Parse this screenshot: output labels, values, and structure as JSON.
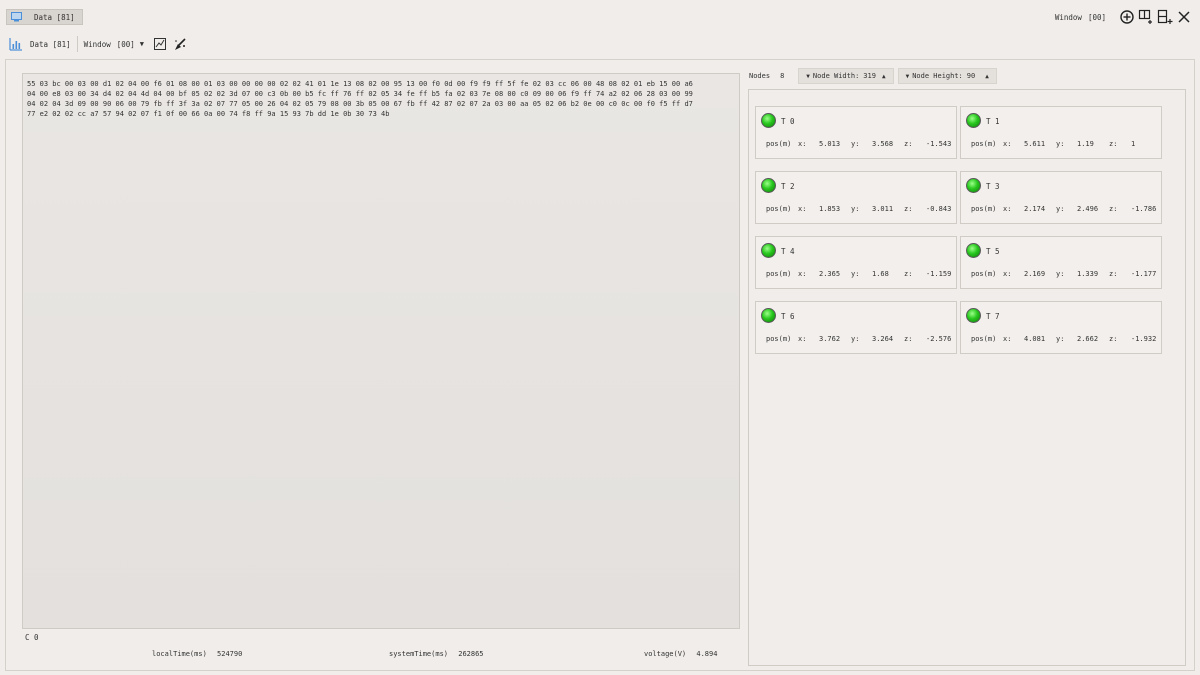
{
  "tab": {
    "label": "Data [81]"
  },
  "topbar": {
    "window_label": "Window",
    "window_value": "[00]"
  },
  "toolbar": {
    "data_label": "Data [81]",
    "window_label": "Window",
    "window_value": "[00]",
    "caret": "▼"
  },
  "hex_lines": [
    "55 03 bc 00 03 00 d1 02 04 00 f6 01 08 00 01 03 00 00 00 00 02 02 41 01 1e 13 08 02 00 95 13 00 f0 0d 00 f9 f9 ff 5f fe 02 03 cc 06 00 48 08 02 01 eb 15 00 a6",
    "04 00 e8 03 00 34 d4 02 04 4d 04 00 bf 05 02 02 3d 07 00 c3 0b 00 b5 fc ff 76 ff 02 05 34 fe ff b5 fa 02 03 7e 08 00 c0 09 00 06 f9 ff 74 a2 02 06 28 03 00 99",
    "04 02 04 3d 09 00 90 06 00 79 fb ff 3f 3a 02 07 77 05 00 26 04 02 05 79 08 00 3b 05 00 67 fb ff 42 87 02 07 2a 03 00 aa 05 02 06 b2 0e 00 c0 0c 00 f0 f5 ff d7",
    "77 e2 02 02 cc a7 57 94 02 07 f1 0f 00 66 0a 00 74 f8 ff 9a 15 93 7b dd 1e 0b 30 73 4b"
  ],
  "left_status": {
    "c_label": "C 0"
  },
  "status": {
    "local_label": "localTime(ms)",
    "local_value": "524790",
    "system_label": "systemTime(ms)",
    "system_value": "262865",
    "voltage_label": "voltage(V)",
    "voltage_value": "4.894"
  },
  "controls": {
    "nodes_label": "Nodes",
    "nodes_value": "8",
    "node_width_label": "Node Width:",
    "node_width_value": "319",
    "node_height_label": "Node Height:",
    "node_height_value": "90",
    "down_arrow": "▼",
    "up_arrow": "▲"
  },
  "nodes": [
    {
      "name": "T 0",
      "pos_label": "pos(m)",
      "x_label": "x:",
      "x": "5.013",
      "y_label": "y:",
      "y": "3.568",
      "z_label": "z:",
      "z": "-1.543"
    },
    {
      "name": "T 1",
      "pos_label": "pos(m)",
      "x_label": "x:",
      "x": "5.611",
      "y_label": "y:",
      "y": "1.19",
      "z_label": "z:",
      "z": "1"
    },
    {
      "name": "T 2",
      "pos_label": "pos(m)",
      "x_label": "x:",
      "x": "1.853",
      "y_label": "y:",
      "y": "3.011",
      "z_label": "z:",
      "z": "-0.843"
    },
    {
      "name": "T 3",
      "pos_label": "pos(m)",
      "x_label": "x:",
      "x": "2.174",
      "y_label": "y:",
      "y": "2.496",
      "z_label": "z:",
      "z": "-1.786"
    },
    {
      "name": "T 4",
      "pos_label": "pos(m)",
      "x_label": "x:",
      "x": "2.365",
      "y_label": "y:",
      "y": "1.68",
      "z_label": "z:",
      "z": "-1.159"
    },
    {
      "name": "T 5",
      "pos_label": "pos(m)",
      "x_label": "x:",
      "x": "2.169",
      "y_label": "y:",
      "y": "1.339",
      "z_label": "z:",
      "z": "-1.177"
    },
    {
      "name": "T 6",
      "pos_label": "pos(m)",
      "x_label": "x:",
      "x": "3.762",
      "y_label": "y:",
      "y": "3.264",
      "z_label": "z:",
      "z": "-2.576"
    },
    {
      "name": "T 7",
      "pos_label": "pos(m)",
      "x_label": "x:",
      "x": "4.081",
      "y_label": "y:",
      "y": "2.662",
      "z_label": "z:",
      "z": "-1.932"
    }
  ],
  "colors": {
    "led_green": "#28c81e",
    "accent_blue": "#4a8fd8"
  }
}
